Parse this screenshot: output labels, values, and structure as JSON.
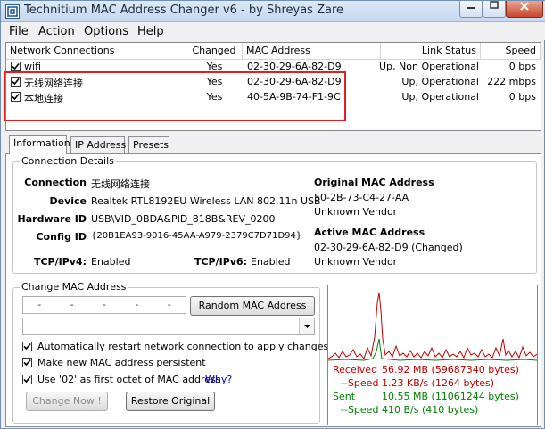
{
  "window": {
    "title": "Technitium MAC Address Changer v6 - by Shreyas Zare"
  },
  "menu": [
    {
      "label": "File"
    },
    {
      "label": "Action"
    },
    {
      "label": "Options"
    },
    {
      "label": "Help"
    }
  ],
  "list": {
    "headers": [
      "Network Connections",
      "Changed",
      "MAC Address",
      "Link Status",
      "Speed"
    ],
    "rows": [
      {
        "name": "wifi",
        "checked": true,
        "changed": "Yes",
        "mac": "02-30-29-6A-82-D9",
        "link": "Up, Non Operational",
        "speed": "0 bps"
      },
      {
        "name": "无线网络连接",
        "checked": true,
        "changed": "Yes",
        "mac": "02-30-29-6A-82-D9",
        "link": "Up, Operational",
        "speed": "222 mbps"
      },
      {
        "name": "本地连接",
        "checked": true,
        "changed": "Yes",
        "mac": "40-5A-9B-74-F1-9C",
        "link": "Up, Operational",
        "speed": "0 bps"
      }
    ]
  },
  "tabs": [
    {
      "label": "Information"
    },
    {
      "label": "IP Address"
    },
    {
      "label": "Presets"
    }
  ],
  "details": {
    "group_title": "Connection Details",
    "connection_label": "Connection",
    "connection": "无线网络连接",
    "device_label": "Device",
    "device": "Realtek RTL8192EU Wireless LAN 802.11n USB",
    "hardware_label": "Hardware ID",
    "hardware": "USB\\VID_0BDA&PID_818B&REV_0200",
    "config_label": "Config ID",
    "config": "{20B1EA93-9016-45AA-A979-2379C7D71D94}",
    "tcp4_label": "TCP/IPv4:",
    "tcp4": "Enabled",
    "tcp6_label": "TCP/IPv6:",
    "tcp6": "Enabled",
    "orig_title": "Original MAC Address",
    "orig_mac": "50-2B-73-C4-27-AA",
    "orig_vendor": "Unknown Vendor",
    "active_title": "Active MAC Address",
    "active_mac": "02-30-29-6A-82-D9 (Changed)",
    "active_vendor": "Unknown Vendor"
  },
  "change": {
    "group_title": "Change MAC Address",
    "random_btn": "Random MAC Address",
    "opt1": "Automatically restart network connection to apply changes",
    "opt2": "Make new MAC address persistent",
    "opt3": "Use '02' as first octet of MAC address",
    "why": "Why?",
    "change_btn": "Change Now !",
    "restore_btn": "Restore Original"
  },
  "stats": {
    "received_label": "Received",
    "received": "56.92 MB (59687340 bytes)",
    "rspeed_label": "--Speed",
    "rspeed": "1.23 KB/s (1264 bytes)",
    "sent_label": "Sent",
    "sent": "10.55 MB (11061244 bytes)",
    "sspeed_label": "--Speed",
    "sspeed": "410 B/s (410 bytes)",
    "received_color": "#c00000",
    "sent_color": "#008000"
  }
}
